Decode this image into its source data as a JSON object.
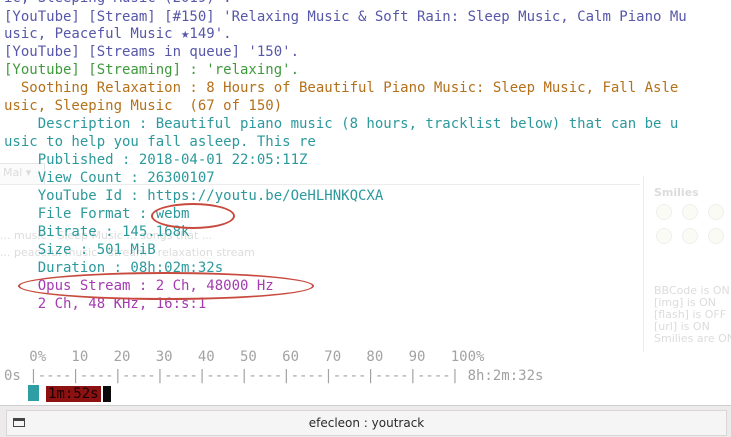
{
  "terminal": {
    "lines": [
      "ic, Sleeping Music (2019)'.",
      "[YouTube] [Stream] [#150] 'Relaxing Music & Soft Rain: Sleep Music, Calm Piano Mu",
      "usic, Peaceful Music ★149'.",
      "[YouTube] [Streams in queue] '150'.",
      "[Youtube] [Streaming] : 'relaxing'.",
      "  Soothing Relaxation : 8 Hours of Beautiful Piano Music: Sleep Music, Fall Asle",
      "usic, Sleeping Music  (67 of 150)",
      "    Description : Beautiful piano music (8 hours, tracklist below) that can be u",
      "usic to help you fall asleep. This re",
      "    Published : 2018-04-01 22:05:11Z",
      "    View Count : 26300107",
      "    YouTube Id : https://youtu.be/OeHLHNKQCXA",
      "    File Format : webm",
      "    Bitrate : 145.168k",
      "    Size : 501 MiB",
      "    Duration : 08h:02m:32s",
      "    Opus Stream : 2 Ch, 48000 Hz",
      "    2 Ch, 48 KHz, 16:s:1"
    ],
    "progress": {
      "percent_scale": "   0%   10   20   30   40   50   60   70   80   90   100%",
      "bar": "0s |----|----|----|----|----|----|----|----|----|----| 8h:2m:32s",
      "elapsed": "1m:52s",
      "fraction": 0.0039
    }
  },
  "background_window": {
    "tab_label": "Mal ▾",
    "line_1": "... music - Sleep Music ... songs that ...",
    "line_2": "... peaceful music - stream - relaxation stream",
    "panel_title": "Smilies",
    "side_notes": [
      "BBCode is ON",
      "[img] is ON",
      "[flash] is OFF",
      "[url] is ON",
      "Smilies are ON"
    ]
  },
  "taskbar": {
    "window_title": "efecleon : youtrack"
  }
}
